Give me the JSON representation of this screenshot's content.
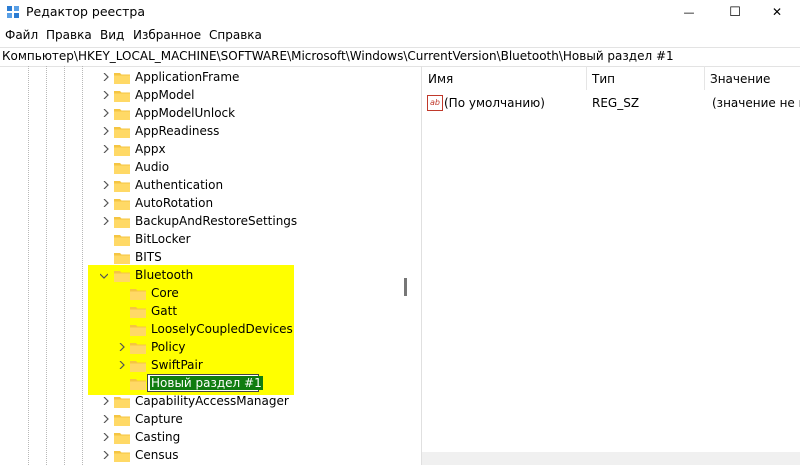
{
  "window": {
    "title": "Редактор реестра",
    "minimize_symbol": "—",
    "maximize_symbol": "☐",
    "close_symbol": "✕"
  },
  "menu": [
    "Файл",
    "Правка",
    "Вид",
    "Избранное",
    "Справка"
  ],
  "address": "Компьютер\\HKEY_LOCAL_MACHINE\\SOFTWARE\\Microsoft\\Windows\\CurrentVersion\\Bluetooth\\Новый раздел #1",
  "tree": [
    {
      "label": "ApplicationFrame",
      "expand": "collapsed",
      "level": 0
    },
    {
      "label": "AppModel",
      "expand": "collapsed",
      "level": 0
    },
    {
      "label": "AppModelUnlock",
      "expand": "collapsed",
      "level": 0
    },
    {
      "label": "AppReadiness",
      "expand": "collapsed",
      "level": 0
    },
    {
      "label": "Appx",
      "expand": "collapsed",
      "level": 0
    },
    {
      "label": "Audio",
      "expand": "none",
      "level": 0
    },
    {
      "label": "Authentication",
      "expand": "collapsed",
      "level": 0
    },
    {
      "label": "AutoRotation",
      "expand": "collapsed",
      "level": 0
    },
    {
      "label": "BackupAndRestoreSettings",
      "expand": "collapsed",
      "level": 0
    },
    {
      "label": "BitLocker",
      "expand": "none",
      "level": 0
    },
    {
      "label": "BITS",
      "expand": "none",
      "level": 0
    },
    {
      "label": "Bluetooth",
      "expand": "expanded",
      "level": 0
    },
    {
      "label": "Core",
      "expand": "none",
      "level": 1
    },
    {
      "label": "Gatt",
      "expand": "none",
      "level": 1
    },
    {
      "label": "LooselyCoupledDevices",
      "expand": "none",
      "level": 1
    },
    {
      "label": "Policy",
      "expand": "collapsed",
      "level": 1
    },
    {
      "label": "SwiftPair",
      "expand": "collapsed",
      "level": 1
    },
    {
      "label": "Новый раздел #1",
      "expand": "none",
      "level": 1,
      "editing": true
    },
    {
      "label": "CapabilityAccessManager",
      "expand": "collapsed",
      "level": 0
    },
    {
      "label": "Capture",
      "expand": "collapsed",
      "level": 0
    },
    {
      "label": "Casting",
      "expand": "collapsed",
      "level": 0
    },
    {
      "label": "Census",
      "expand": "collapsed",
      "level": 0
    }
  ],
  "columns": {
    "name": "Имя",
    "type": "Тип",
    "value": "Значение"
  },
  "values": [
    {
      "icon": "string-value-icon",
      "icon_text": "ab",
      "name": "(По умолчанию)",
      "type": "REG_SZ",
      "data": "(значение не пр"
    }
  ],
  "colors": {
    "highlight": "#ffff00",
    "edit_selection": "#107c10",
    "folder": "#f5c542"
  }
}
